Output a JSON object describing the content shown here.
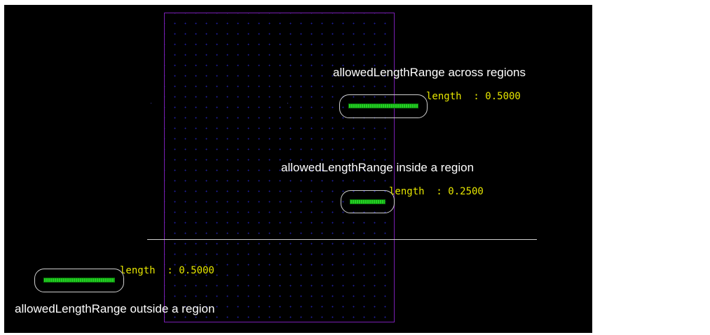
{
  "regions": {
    "across": {
      "caption": "allowedLengthRange across regions",
      "readout": "length  : 0.5000"
    },
    "inside": {
      "caption": "allowedLengthRange inside a region",
      "readout": "length  : 0.2500"
    },
    "outside": {
      "caption": "allowedLengthRange outside a region",
      "readout": "length  : 0.5000"
    }
  },
  "colors": {
    "background": "#000000",
    "region_border": "#7a1fb3",
    "grid_dot": "#1f1f9e",
    "wire": "#1fbf1f",
    "selection_outline": "#cfcfcf",
    "caption_text": "#ffffff",
    "readout_text": "#e6e600"
  }
}
